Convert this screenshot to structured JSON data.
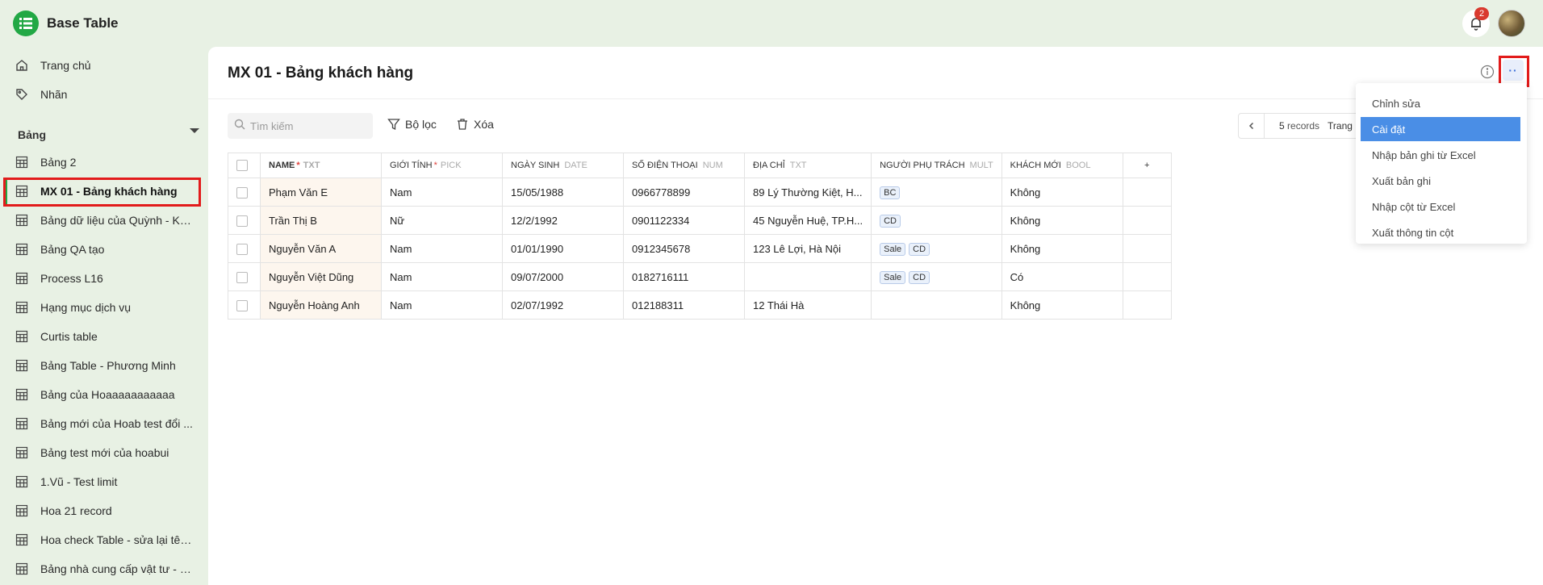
{
  "app": {
    "title": "Base Table",
    "notification_count": "2"
  },
  "sidebar": {
    "top_items": [
      {
        "label": "Trang chủ",
        "icon": "home-icon"
      },
      {
        "label": "Nhãn",
        "icon": "tag-icon"
      }
    ],
    "section_title": "Bảng",
    "tables": [
      {
        "label": "Bảng 2"
      },
      {
        "label": "MX 01 - Bảng khách hàng",
        "active": true
      },
      {
        "label": "Bảng dữ liệu của Quỳnh - KH..."
      },
      {
        "label": "Bảng QA tạo"
      },
      {
        "label": "Process L16"
      },
      {
        "label": "Hạng mục dịch vụ"
      },
      {
        "label": "Curtis table"
      },
      {
        "label": "Bảng Table - Phương Minh"
      },
      {
        "label": "Bảng của Hoaaaaaaaaaaa"
      },
      {
        "label": "Bảng mới của Hoab test đổi ..."
      },
      {
        "label": "Bảng test mới của hoabui"
      },
      {
        "label": "1.Vũ - Test limit"
      },
      {
        "label": "Hoa 21 record"
      },
      {
        "label": "Hoa check Table - sửa lại tên..."
      },
      {
        "label": "Bảng nhà cung cấp vật tư - CE"
      }
    ]
  },
  "main": {
    "title": "MX 01 - Bảng khách hàng",
    "more_label": "··",
    "search_placeholder": "Tìm kiếm",
    "filter_label": "Bộ lọc",
    "delete_label": "Xóa",
    "pager": {
      "count": "5",
      "records_label": "records",
      "page_label": "Trang"
    }
  },
  "table": {
    "columns": [
      {
        "name": "NAME",
        "required": "*",
        "type": "TXT"
      },
      {
        "name": "GIỚI TÍNH",
        "required": "*",
        "type": "PICK"
      },
      {
        "name": "NGÀY SINH",
        "required": "",
        "type": "DATE"
      },
      {
        "name": "SỐ ĐIỆN THOẠI",
        "required": "",
        "type": "NUM"
      },
      {
        "name": "ĐỊA CHỈ",
        "required": "",
        "type": "TXT"
      },
      {
        "name": "NGƯỜI PHỤ TRÁCH",
        "required": "",
        "type": "MULT"
      },
      {
        "name": "KHÁCH MỚI",
        "required": "",
        "type": "BOOL"
      }
    ],
    "add_column_symbol": "+",
    "rows": [
      {
        "name": "Phạm Văn E",
        "gender": "Nam",
        "dob": "15/05/1988",
        "phone": "0966778899",
        "address": "89 Lý Thường Kiệt, H...",
        "owners": [
          "BC"
        ],
        "new": "Không"
      },
      {
        "name": "Trần Thị B",
        "gender": "Nữ",
        "dob": "12/2/1992",
        "phone": "0901122334",
        "address": "45 Nguyễn Huệ, TP.H...",
        "owners": [
          "CD"
        ],
        "new": "Không"
      },
      {
        "name": "Nguyễn Văn A",
        "gender": "Nam",
        "dob": "01/01/1990",
        "phone": "0912345678",
        "address": "123 Lê Lợi, Hà Nội",
        "owners": [
          "Sale",
          "CD"
        ],
        "new": "Không"
      },
      {
        "name": "Nguyễn Việt Dũng",
        "gender": "Nam",
        "dob": "09/07/2000",
        "phone": "0182716111",
        "address": "",
        "owners": [
          "Sale",
          "CD"
        ],
        "new": "Có"
      },
      {
        "name": "Nguyễn Hoàng Anh",
        "gender": "Nam",
        "dob": "02/07/1992",
        "phone": "012188311",
        "address": "12 Thái Hà",
        "owners": [],
        "new": "Không"
      }
    ]
  },
  "menu": {
    "items": [
      {
        "label": "Chỉnh sửa"
      },
      {
        "label": "Cài đặt",
        "selected": true
      },
      {
        "label": "Nhập bản ghi từ Excel"
      },
      {
        "label": "Xuất bản ghi"
      },
      {
        "label": "Nhập cột từ Excel"
      },
      {
        "label": "Xuất thông tin cột"
      }
    ]
  },
  "colors": {
    "brand": "#22a845",
    "highlight": "#e21b1b",
    "selected": "#4a8ee6",
    "sidebar_bg": "#e8f1e4"
  }
}
